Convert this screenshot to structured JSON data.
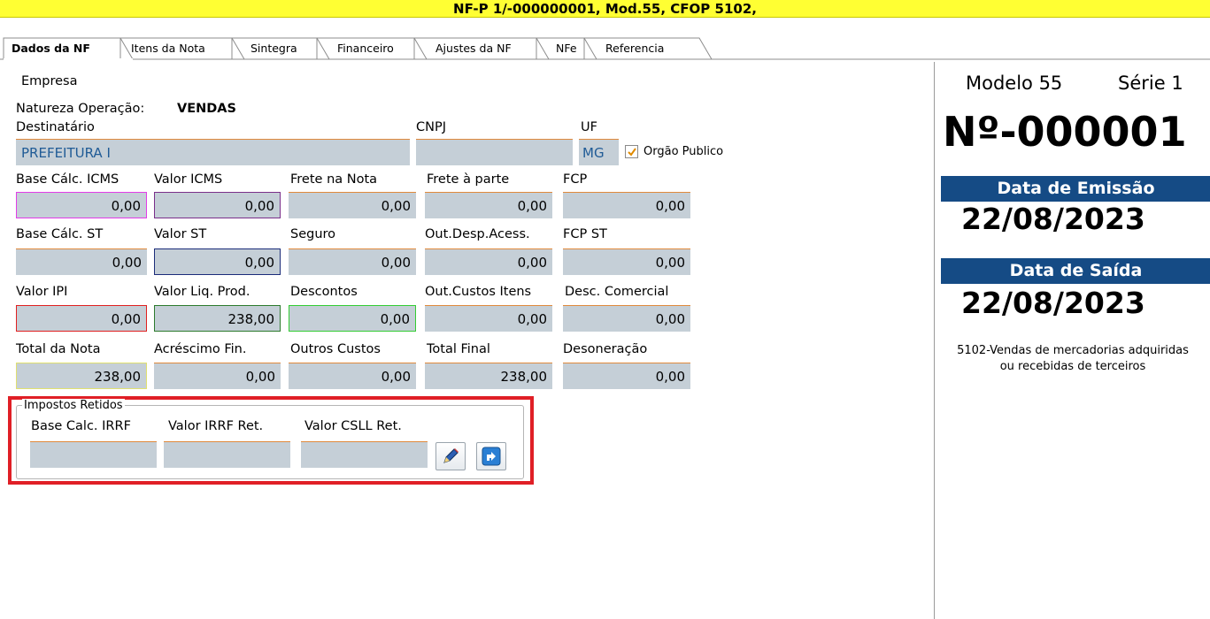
{
  "title": "NF-P 1/-000000001, Mod.55, CFOP 5102,",
  "tabs": [
    "Dados da NF",
    "Itens da Nota",
    "Sintegra",
    "Financeiro",
    "Ajustes da NF",
    "NFe",
    "Referencia"
  ],
  "company_label": "Empresa",
  "natureza_label": "Natureza Operação:",
  "natureza_value": "VENDAS",
  "destinatario_label": "Destinatário",
  "destinatario_value": "PREFEITURA I",
  "cnpj_label": "CNPJ",
  "uf_label": "UF",
  "uf_value": "MG",
  "orgao_publico_label": "Orgão Publico",
  "orgao_publico_checked": true,
  "row1": {
    "labels": [
      "Base Cálc. ICMS",
      "Valor ICMS",
      "Frete na Nota",
      "Frete à parte",
      "FCP"
    ],
    "values": [
      "0,00",
      "0,00",
      "0,00",
      "0,00",
      "0,00"
    ]
  },
  "row2": {
    "labels": [
      "Base Cálc. ST",
      "Valor ST",
      "Seguro",
      "Out.Desp.Acess.",
      "FCP ST"
    ],
    "values": [
      "0,00",
      "0,00",
      "0,00",
      "0,00",
      "0,00"
    ]
  },
  "row3": {
    "labels": [
      "Valor IPI",
      "Valor Liq. Prod.",
      "Descontos",
      "Out.Custos Itens",
      "Desc. Comercial"
    ],
    "values": [
      "0,00",
      "238,00",
      "0,00",
      "0,00",
      "0,00"
    ]
  },
  "row4": {
    "labels": [
      "Total da Nota",
      "Acréscimo Fin.",
      "Outros Custos",
      "Total Final",
      "Desoneração"
    ],
    "values": [
      "238,00",
      "0,00",
      "0,00",
      "238,00",
      "0,00"
    ]
  },
  "impostos": {
    "title": "Impostos Retidos",
    "labels": [
      "Base Calc. IRRF",
      "Valor IRRF Ret.",
      "Valor CSLL Ret."
    ],
    "values": [
      "",
      "",
      ""
    ],
    "edit_icon": "pencil-icon",
    "refresh_icon": "refresh-arrow-icon"
  },
  "side": {
    "modelo": "Modelo 55",
    "serie": "Série 1",
    "numero": "Nº-000001",
    "data_emissao_label": "Data de Emissão",
    "data_emissao": "22/08/2023",
    "data_saida_label": "Data de Saída",
    "data_saida": "22/08/2023",
    "cfop_line1": "5102-Vendas de mercadorias adquiridas",
    "cfop_line2": "ou recebidas de terceiros"
  },
  "colors": {
    "title_bg": "#ffff33",
    "field_bg": "#c5cfd7",
    "field_top_border": "#e08a3c",
    "side_bar": "#154b85",
    "highlight_red": "#e01f26"
  }
}
